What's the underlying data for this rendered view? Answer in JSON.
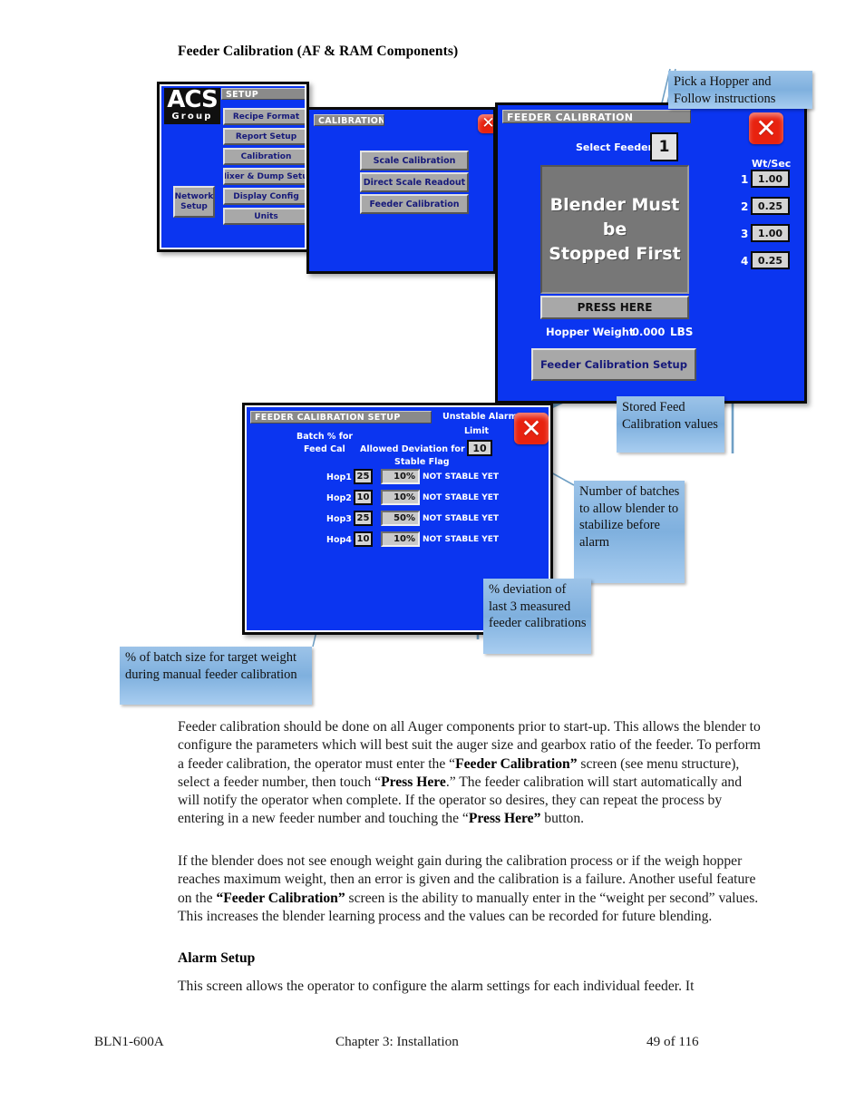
{
  "document": {
    "title": "Feeder Calibration (AF & RAM Components)",
    "paragraph1_html": "Feeder calibration should be done on all Auger components prior to start-up.  This allows the blender to configure the parameters which will best suit the auger size and gearbox ratio of the feeder.  To perform a feeder calibration, the operator must enter the “<b>Feeder Calibration”</b> screen (see menu structure), select a feeder number, then touch “<b>Press Here</b>.” The feeder calibration will start automatically and will notify the operator when complete.  If the operator so desires, they can repeat the process by entering in a new feeder number and touching the “<b>Press Here”</b> button.",
    "paragraph2_html": "If the blender does not see enough weight gain during the calibration process or if the weigh hopper reaches maximum weight, then an error is given and the calibration is a failure.  Another useful feature on the <b>“Feeder Calibration”</b> screen is the ability to manually enter in the “weight per second” values.  This increases the blender learning process and the values can be recorded for future blending.",
    "section_heading": "Alarm Setup",
    "paragraph3_html": "This screen allows the operator to configure the alarm settings for each individual feeder.  It",
    "footer": {
      "left": "BLN1-600A",
      "center": "Chapter 3: Installation",
      "right": "49 of 116"
    }
  },
  "setup_screen": {
    "title": "SETUP",
    "logo_line1": "ACS",
    "logo_line2": "Group",
    "close_label": "✕",
    "menu_buttons": [
      "Recipe Format",
      "Report Setup",
      "Calibration",
      "Mixer & Dump Setup",
      "Display Config",
      "Units"
    ],
    "network_setup_line1": "Network",
    "network_setup_line2": "Setup"
  },
  "calibration_screen": {
    "title": "CALIBRATION",
    "close_label": "✕",
    "buttons": [
      "Scale Calibration",
      "Direct Scale Readout",
      "Feeder Calibration"
    ]
  },
  "feeder_calibration_screen": {
    "title": "FEEDER CALIBRATION",
    "close_label": "✕",
    "select_feeder_label": "Select Feeder",
    "select_feeder_value": "1",
    "message_line1": "Blender Must be",
    "message_line2": "Stopped First",
    "press_here_label": "PRESS HERE",
    "hopper_weight_label": "Hopper Weight",
    "hopper_weight_value": "0.000",
    "hopper_weight_units": "LBS",
    "setup_button_label": "Feeder Calibration Setup",
    "wt_per_sec_header": "Wt/Sec",
    "wt_per_sec_rows": [
      {
        "index": "1",
        "value": "1.00"
      },
      {
        "index": "2",
        "value": "0.25"
      },
      {
        "index": "3",
        "value": "1.00"
      },
      {
        "index": "4",
        "value": "0.25"
      }
    ]
  },
  "feeder_calibration_setup_screen": {
    "title": "FEEDER CALIBRATION SETUP",
    "close_label": "✕",
    "batch_pct_label_line1": "Batch % for",
    "batch_pct_label_line2": "Feed Cal",
    "allowed_dev_label_line1": "Allowed Deviation for",
    "allowed_dev_label_line2": "Stable Flag",
    "unstable_alarm_label_line1": "Unstable Alarm",
    "unstable_alarm_label_line2": "Limit",
    "unstable_alarm_value": "10",
    "rows": [
      {
        "hopper": "Hop1",
        "batch_pct": "25",
        "deviation": "10%",
        "status": "NOT STABLE YET"
      },
      {
        "hopper": "Hop2",
        "batch_pct": "10",
        "deviation": "10%",
        "status": "NOT STABLE YET"
      },
      {
        "hopper": "Hop3",
        "batch_pct": "25",
        "deviation": "50%",
        "status": "NOT STABLE YET"
      },
      {
        "hopper": "Hop4",
        "batch_pct": "10",
        "deviation": "10%",
        "status": "NOT STABLE YET"
      }
    ]
  },
  "callouts": {
    "pick_hopper": "Pick a Hopper and Follow instructions",
    "stored_values": "Stored Feed Calibration values",
    "num_batches": "Number of batches to allow blender to stabilize before alarm",
    "pct_deviation": "% deviation of last 3 measured feeder calibrations",
    "pct_batch_size": "% of batch size for target weight during manual feeder calibration"
  },
  "colors": {
    "hmi_blue": "#0b35f0",
    "panel_gray": "#a8a8a8",
    "close_red": "#e8220f",
    "callout_blue": "#8fbce4",
    "leader_blue": "#6f9fc4"
  }
}
